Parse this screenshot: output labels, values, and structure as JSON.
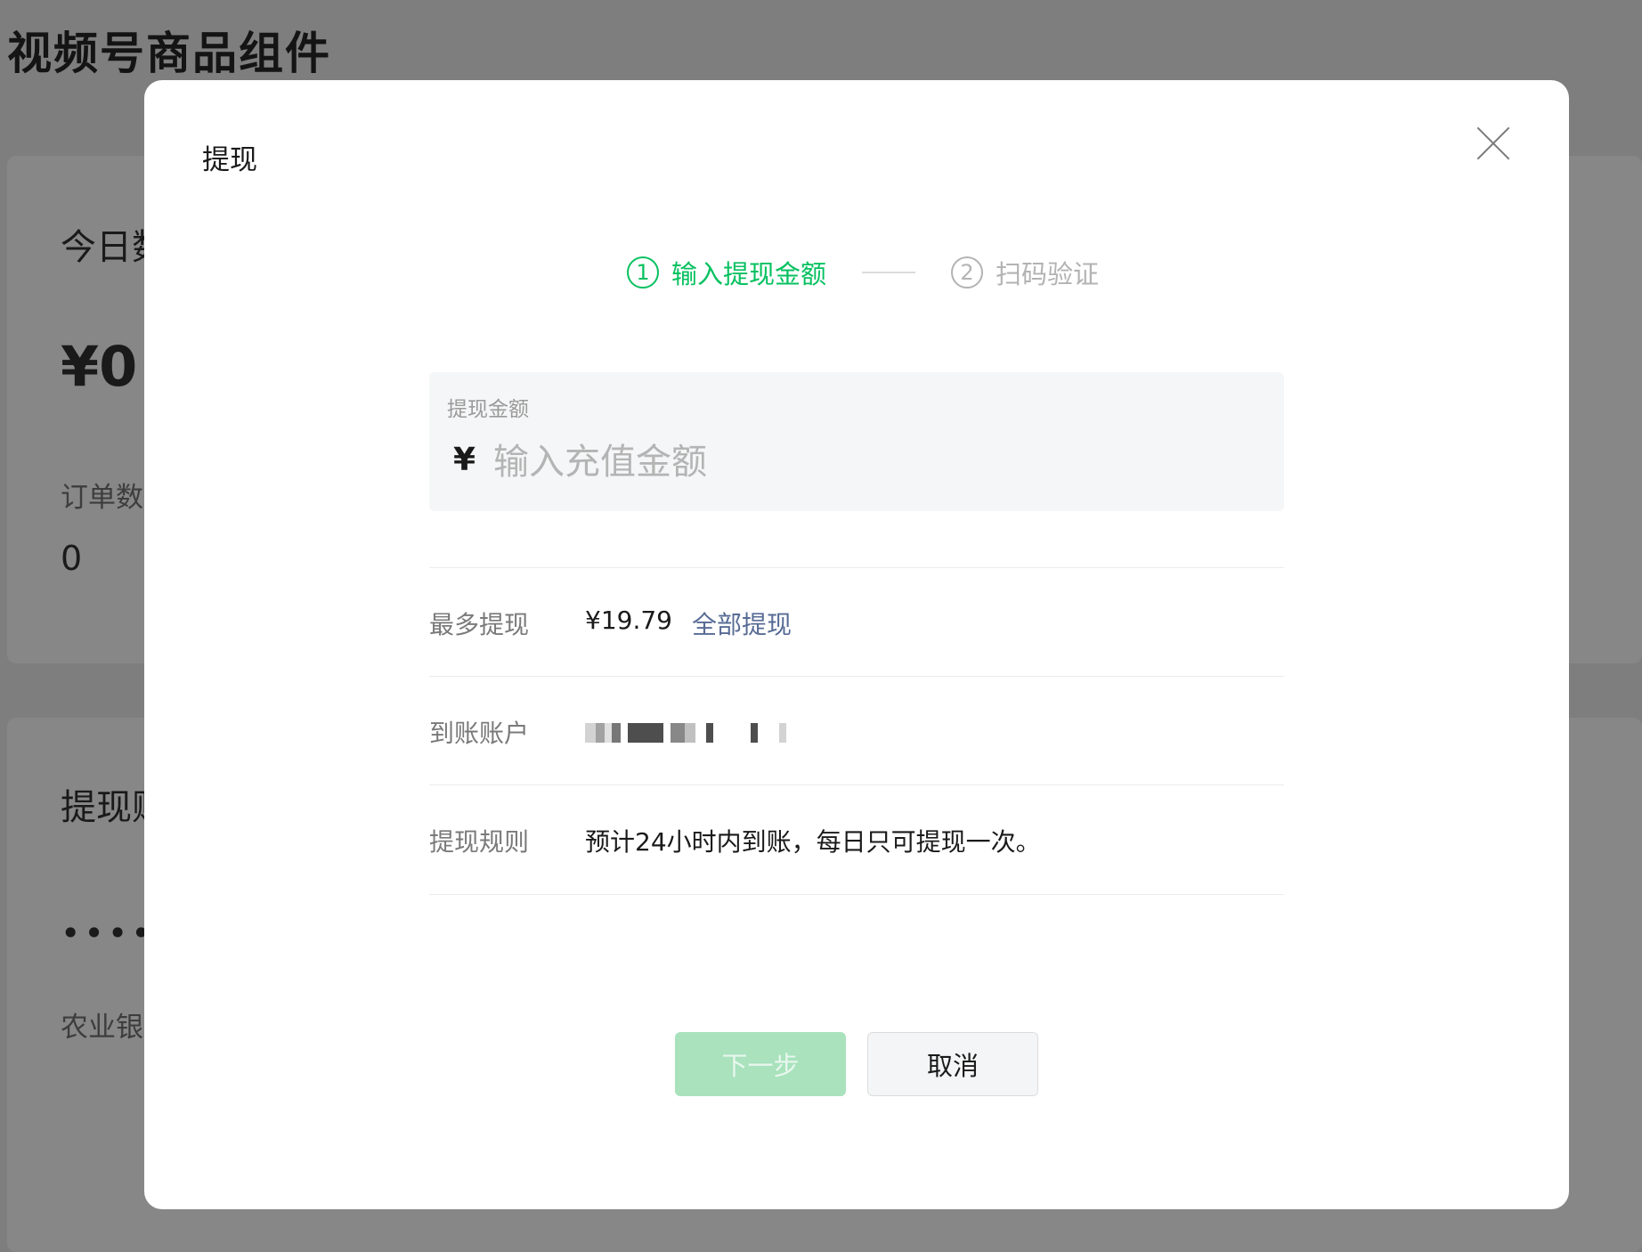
{
  "background": {
    "page_title": "视频号商品组件",
    "card1": {
      "heading": "今日数",
      "amount": "¥0",
      "orders_label": "订单数",
      "orders_value": "0"
    },
    "card2": {
      "heading": "提现账",
      "masked": "••••",
      "bank": "农业银"
    }
  },
  "modal": {
    "title": "提现",
    "close_icon": "close-icon",
    "steps": [
      {
        "num": "1",
        "label": "输入提现金额",
        "state": "active"
      },
      {
        "num": "2",
        "label": "扫码验证",
        "state": "inactive"
      }
    ],
    "amount_field": {
      "label": "提现金额",
      "currency": "¥",
      "placeholder": "输入充值金额",
      "value": ""
    },
    "rows": {
      "max": {
        "label": "最多提现",
        "value": "¥19.79",
        "action": "全部提现"
      },
      "account": {
        "label": "到账账户"
      },
      "rule": {
        "label": "提现规则",
        "value": "预计24小时内到账，每日只可提现一次。"
      }
    },
    "buttons": {
      "next": "下一步",
      "cancel": "取消"
    }
  },
  "colors": {
    "accent_green": "#07c160",
    "link_blue": "#576b95",
    "overlay": "#7d7e7d"
  }
}
